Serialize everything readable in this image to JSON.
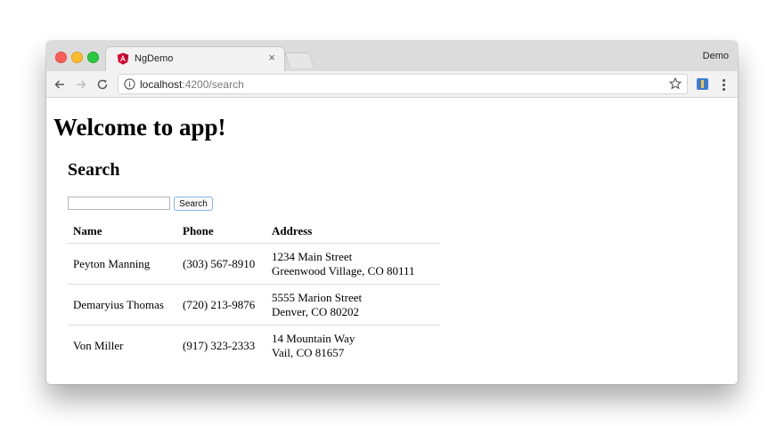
{
  "browser": {
    "tab": {
      "title": "NgDemo",
      "close": "×"
    },
    "profile_name": "Demo",
    "url": {
      "host": "localhost",
      "path": ":4200/search"
    }
  },
  "page": {
    "heading": "Welcome to app!",
    "subheading": "Search",
    "search": {
      "value": "",
      "button_label": "Search"
    },
    "table": {
      "headers": [
        "Name",
        "Phone",
        "Address"
      ],
      "rows": [
        {
          "name": "Peyton Manning",
          "phone": "(303) 567-8910",
          "street": "1234 Main Street",
          "city": "Greenwood Village, CO 80111"
        },
        {
          "name": "Demaryius Thomas",
          "phone": "(720) 213-9876",
          "street": "5555 Marion Street",
          "city": "Denver, CO 80202"
        },
        {
          "name": "Von Miller",
          "phone": "(917) 323-2333",
          "street": "14 Mountain Way",
          "city": "Vail, CO 81657"
        }
      ]
    }
  },
  "colors": {
    "close_button": "#fc5d56",
    "minimize_button": "#fdbc2e",
    "zoom_button": "#28c840",
    "angular_red": "#dd0031"
  },
  "icons": [
    "angular-favicon-icon",
    "back-arrow-icon",
    "forward-arrow-icon",
    "reload-icon",
    "info-icon",
    "star-icon",
    "extension-icon",
    "menu-dots-icon"
  ]
}
